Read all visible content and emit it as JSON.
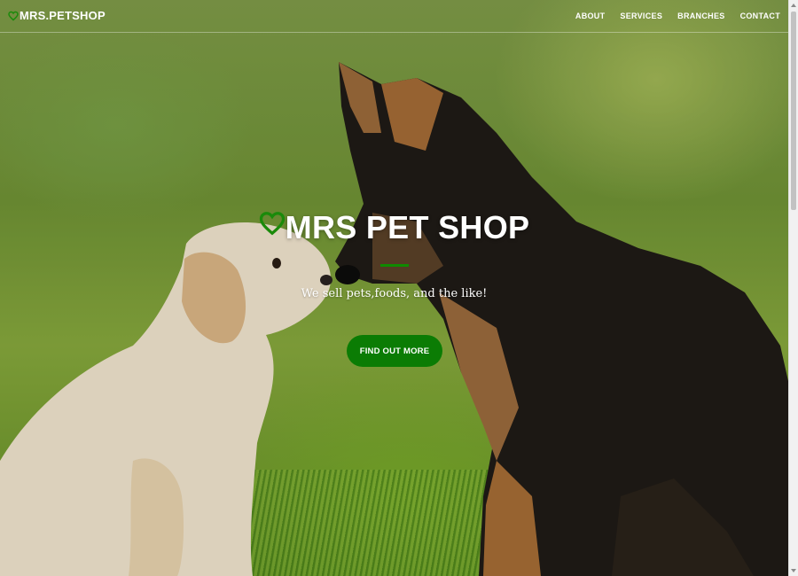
{
  "navbar": {
    "brand": "MRS.PETSHOP",
    "links": [
      "ABOUT",
      "SERVICES",
      "BRANCHES",
      "CONTACT"
    ]
  },
  "hero": {
    "title": "MRS PET SHOP",
    "subtitle": "We sell pets,foods, and the like!",
    "cta_label": "FIND OUT MORE"
  },
  "colors": {
    "accent": "#0b7c04",
    "heart": "#1a8a0a",
    "text": "#ffffff"
  },
  "icons": {
    "brand_icon": "heart-outline-icon",
    "title_icon": "heart-outline-icon"
  },
  "image": {
    "subject": "puppies"
  }
}
